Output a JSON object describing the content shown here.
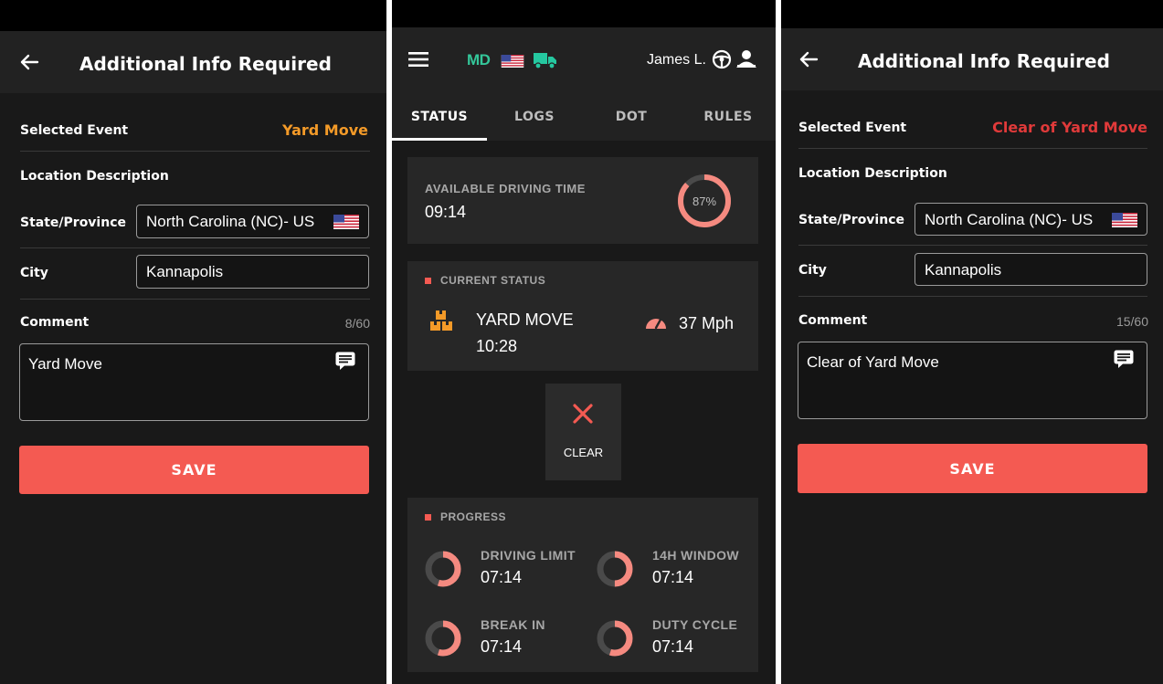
{
  "colors": {
    "accent": "#f45a52",
    "orange": "#f39a28",
    "background": "#191919",
    "appbar": "#222222",
    "card": "#272727",
    "gauge_track": "#4a4a4a",
    "logo_md_green": "#34c79a",
    "logo_md_red": "#f45a52",
    "truck_green": "#25c8a0"
  },
  "screen_left": {
    "title": "Additional Info Required",
    "back_icon": "arrow-left-icon",
    "selected_event_label": "Selected Event",
    "selected_event_value": "Yard Move",
    "selected_event_color": "#f39a28",
    "location_description_label": "Location Description",
    "state_label": "State/Province",
    "state_value": "North Carolina (NC)- US",
    "flag_icon": "us-flag-icon",
    "city_label": "City",
    "city_value": "Kannapolis",
    "comment_label": "Comment",
    "comment_counter": "8/60",
    "comment_value": "Yard Move",
    "comment_icon": "message-icon",
    "save_label": "SAVE"
  },
  "screen_middle": {
    "menu_icon": "hamburger-menu-icon",
    "logo_text": "MD",
    "flag_icon": "us-flag-icon",
    "truck_icon": "truck-icon",
    "driver_name": "James L.",
    "steering_icon": "steering-wheel-icon",
    "codriver_icon": "co-driver-icon",
    "tabs": [
      {
        "label": "STATUS",
        "active": true
      },
      {
        "label": "LOGS",
        "active": false
      },
      {
        "label": "DOT",
        "active": false
      },
      {
        "label": "RULES",
        "active": false
      }
    ],
    "available_driving": {
      "label": "AVAILABLE DRIVING TIME",
      "value": "09:14",
      "percent_text": "87%",
      "percent": 0.87
    },
    "current_status": {
      "label": "CURRENT STATUS",
      "status_icon": "yard-move-boxes-icon",
      "status": "YARD MOVE",
      "time": "10:28",
      "speed_icon": "speedometer-icon",
      "speed": "37 Mph"
    },
    "clear_button": {
      "icon": "close-x-icon",
      "label": "CLEAR"
    },
    "progress": {
      "label": "PROGRESS",
      "items": [
        {
          "label": "DRIVING LIMIT",
          "value": "07:14",
          "fraction": 0.55
        },
        {
          "label": "14H WINDOW",
          "value": "07:14",
          "fraction": 0.5
        },
        {
          "label": "BREAK IN",
          "value": "07:14",
          "fraction": 0.55
        },
        {
          "label": "DUTY CYCLE",
          "value": "07:14",
          "fraction": 0.55
        }
      ]
    }
  },
  "screen_right": {
    "title": "Additional Info Required",
    "back_icon": "arrow-left-icon",
    "selected_event_label": "Selected Event",
    "selected_event_value": "Clear of Yard Move",
    "selected_event_color": "#e03a3a",
    "location_description_label": "Location Description",
    "state_label": "State/Province",
    "state_value": "North Carolina (NC)- US",
    "flag_icon": "us-flag-icon",
    "city_label": "City",
    "city_value": "Kannapolis",
    "comment_label": "Comment",
    "comment_counter": "15/60",
    "comment_value": "Clear of Yard Move",
    "comment_icon": "message-icon",
    "save_label": "SAVE"
  }
}
